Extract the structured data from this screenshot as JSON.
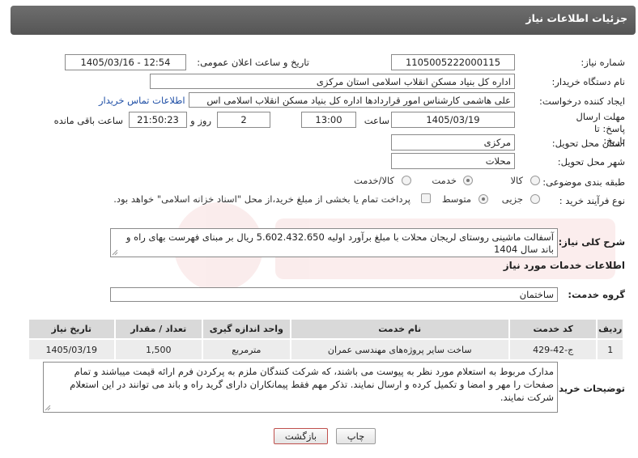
{
  "header": {
    "title": "جزئیات اطلاعات نیاز"
  },
  "fields": {
    "need_number": {
      "label": "شماره نیاز:",
      "value": "1105005222000115"
    },
    "announce_datetime": {
      "label": "تاریخ و ساعت اعلان عمومی:",
      "value": "1405/03/16 - 12:54"
    },
    "buyer_org": {
      "label": "نام دستگاه خریدار:",
      "value": "اداره کل بنیاد مسکن انقلاب اسلامی استان مرکزی"
    },
    "requester": {
      "label": "ایجاد کننده درخواست:",
      "value": "علی هاشمی کارشناس امور قراردادها اداره کل بنیاد مسکن انقلاب اسلامی اس",
      "contact_link": "اطلاعات تماس خریدار"
    },
    "deadline": {
      "label": "مهلت ارسال پاسخ: تا تاریخ:",
      "date": "1405/03/19",
      "time_label": "ساعت",
      "time": "13:00",
      "days": "2",
      "days_label": "روز و",
      "remaining": "21:50:23",
      "remaining_label": "ساعت باقی مانده"
    },
    "province": {
      "label": "استان محل تحویل:",
      "value": "مرکزی"
    },
    "city": {
      "label": "شهر محل تحویل:",
      "value": "محلات"
    },
    "category": {
      "label": "طبقه بندی موضوعی:",
      "options": [
        "کالا",
        "خدمت",
        "کالا/خدمت"
      ],
      "selected": "خدمت"
    },
    "process": {
      "label": "نوع فرآیند خرید :",
      "options": [
        "جزیی",
        "متوسط"
      ],
      "selected": "متوسط",
      "treasury_text": "پرداخت تمام یا بخشی از مبلغ خرید،از محل \"اسناد خزانه اسلامی\" خواهد بود."
    }
  },
  "description": {
    "label": "شرح کلی نیاز:",
    "text": "آسفالت ماشینی روستای لریجان محلات  با مبلغ برآورد اولیه  5.602.432.650 ریال بر مبنای فهرست بهای راه و باند سال 1404"
  },
  "services": {
    "section_title": "اطلاعات خدمات مورد نیاز",
    "group_label": "گروه خدمت:",
    "group_value": "ساختمان",
    "columns": [
      "ردیف",
      "کد خدمت",
      "نام خدمت",
      "واحد اندازه گیری",
      "تعداد / مقدار",
      "تاریخ نیاز"
    ],
    "rows": [
      [
        "1",
        "ج-42-429",
        "ساخت سایر پروژه‌های مهندسی عمران",
        "مترمربع",
        "1,500",
        "1405/03/19"
      ]
    ]
  },
  "buyer_notes": {
    "label": "توضیحات خریدار:",
    "text": "مدارک مربوط به استعلام مورد نظر به پیوست می باشند، که شرکت کنندگان ملزم به پرکردن فرم ارائه قیمت میباشند و تمام صفحات را مهر و امضا و تکمیل کرده و ارسال نمایند. تذکر مهم فقط پیمانکاران دارای گرید راه و باند می توانند در این استعلام شرکت نمایند."
  },
  "buttons": {
    "print": "چاپ",
    "back": "بازگشت"
  },
  "colors": {
    "header_bg": "#5f5f5f",
    "link": "#1f4fa6",
    "back_button_border": "#c0504d"
  }
}
